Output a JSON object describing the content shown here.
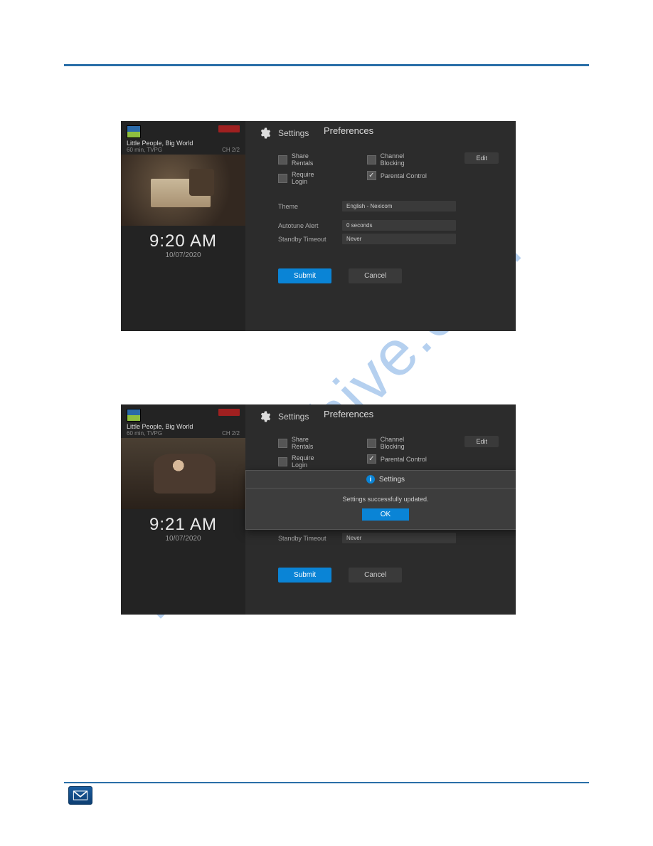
{
  "watermark": "manualshive.com",
  "panel1": {
    "program_title": "Little People, Big World",
    "program_sub": "60 min, TVPG",
    "channel": "CH 2/2",
    "clock": "9:20 AM",
    "date": "10/07/2020",
    "settings_label": "Settings",
    "prefs_title": "Preferences",
    "checks": {
      "share_rentals": "Share Rentals",
      "require_login": "Require Login",
      "channel_blocking": "Channel Blocking",
      "parental_control": "Parental Control"
    },
    "edit": "Edit",
    "rows": {
      "theme_label": "Theme",
      "theme_value": "English - Nexicom",
      "autotune_label": "Autotune Alert",
      "autotune_value": "0 seconds",
      "standby_label": "Standby Timeout",
      "standby_value": "Never"
    },
    "submit": "Submit",
    "cancel": "Cancel"
  },
  "panel2": {
    "program_title": "Little People, Big World",
    "program_sub": "60 min, TVPG",
    "channel": "CH 2/2",
    "clock": "9:21 AM",
    "date": "10/07/2020",
    "settings_label": "Settings",
    "prefs_title": "Preferences",
    "checks": {
      "share_rentals": "Share Rentals",
      "require_login": "Require Login",
      "channel_blocking": "Channel Blocking",
      "parental_control": "Parental Control"
    },
    "edit": "Edit",
    "rows": {
      "standby_label": "Standby Timeout",
      "standby_value": "Never"
    },
    "dialog": {
      "title": "Settings",
      "message": "Settings successfully updated.",
      "ok": "OK"
    },
    "submit": "Submit",
    "cancel": "Cancel"
  }
}
